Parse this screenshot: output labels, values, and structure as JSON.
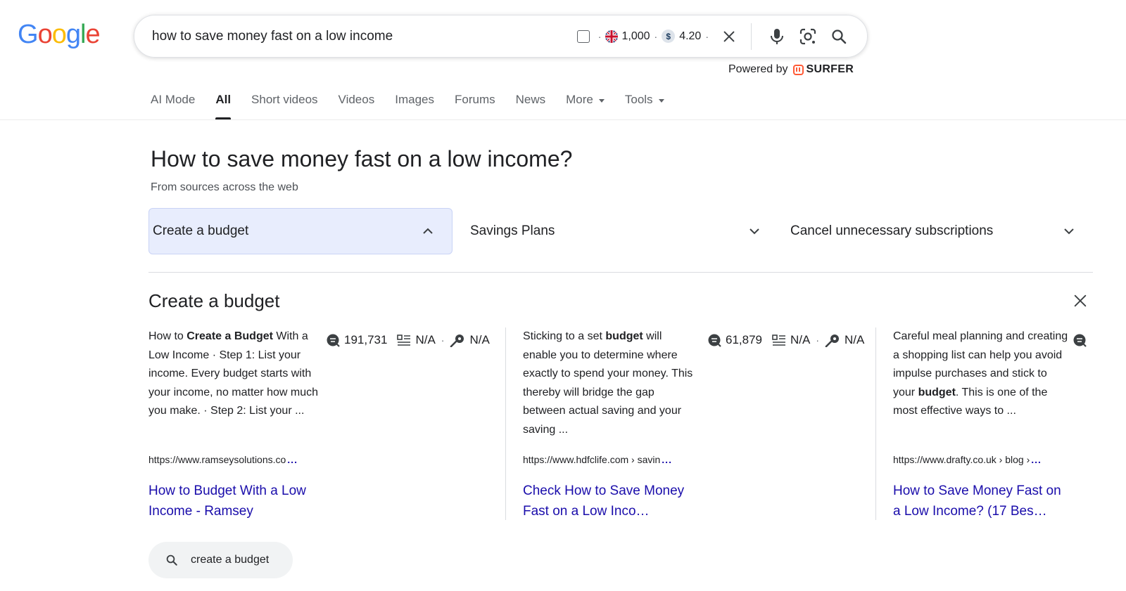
{
  "brand": {
    "logo_letters": [
      "G",
      "o",
      "o",
      "g",
      "l",
      "e"
    ],
    "logo_colors": [
      "#4285F4",
      "#EA4335",
      "#FBBC05",
      "#4285F4",
      "#34A853",
      "#EA4335"
    ]
  },
  "search": {
    "query": "how to save money fast on a low income",
    "volume": "1,000",
    "cpc": "4.20",
    "flag_icon": "uk-flag-icon",
    "cpc_icon": "dollar-icon",
    "clear_icon": "close-icon",
    "voice_icon": "microphone-icon",
    "lens_icon": "camera-lens-icon",
    "search_icon": "search-icon"
  },
  "powered_by": {
    "label": "Powered by",
    "brand": "SURFER",
    "brand_color": "#ff5a36"
  },
  "tabs": [
    {
      "label": "AI Mode",
      "active": false
    },
    {
      "label": "All",
      "active": true
    },
    {
      "label": "Short videos",
      "active": false
    },
    {
      "label": "Videos",
      "active": false
    },
    {
      "label": "Images",
      "active": false
    },
    {
      "label": "Forums",
      "active": false
    },
    {
      "label": "News",
      "active": false
    },
    {
      "label": "More",
      "active": false,
      "dropdown": true
    },
    {
      "label": "Tools",
      "active": false,
      "dropdown": true
    }
  ],
  "question": {
    "title": "How to save money fast on a low income?",
    "subtitle": "From sources across the web"
  },
  "chips": [
    {
      "label": "Create a budget",
      "expanded": true
    },
    {
      "label": "Savings Plans",
      "expanded": false
    },
    {
      "label": "Cancel unnecessary subscriptions",
      "expanded": false
    }
  ],
  "panel": {
    "title": "Create a budget",
    "cards": [
      {
        "snippet_parts": [
          {
            "text": "How to ",
            "bold": false
          },
          {
            "text": "Create a Budget",
            "bold": true
          },
          {
            "text": " With a Low Income · Step 1: List your income. Every budget starts with your income, no matter how much you make. · Step 2: List your ...",
            "bold": false
          }
        ],
        "metric_volume": "191,731",
        "metric_words": "N/A",
        "metric_keywords": "N/A",
        "url": "https://www.ramseysolutions.co",
        "url_more": "...",
        "link": "How to Budget With a Low Income - Ramsey"
      },
      {
        "snippet_parts": [
          {
            "text": "Sticking to a set ",
            "bold": false
          },
          {
            "text": "budget",
            "bold": true
          },
          {
            "text": " will enable you to determine where exactly to spend your money. This thereby will bridge the gap between actual saving and your saving ...",
            "bold": false
          }
        ],
        "metric_volume": "61,879",
        "metric_words": "N/A",
        "metric_keywords": "N/A",
        "url": "https://www.hdfclife.com › savin",
        "url_more": "...",
        "link": "Check How to Save Money Fast on a Low Inco…"
      },
      {
        "snippet_parts": [
          {
            "text": "Careful meal planning and creating a shopping list can help you avoid impulse purchases and stick to your ",
            "bold": false
          },
          {
            "text": "budget",
            "bold": true
          },
          {
            "text": ". This is one of the most effective ways to ...",
            "bold": false
          }
        ],
        "metric_volume": "",
        "metric_words": "",
        "metric_keywords": "",
        "url": "https://www.drafty.co.uk › blog ›",
        "url_more": "...",
        "link": "How to Save Money Fast on a Low Income? (17 Bes…"
      }
    ]
  },
  "related_search": {
    "label": "create a budget"
  }
}
